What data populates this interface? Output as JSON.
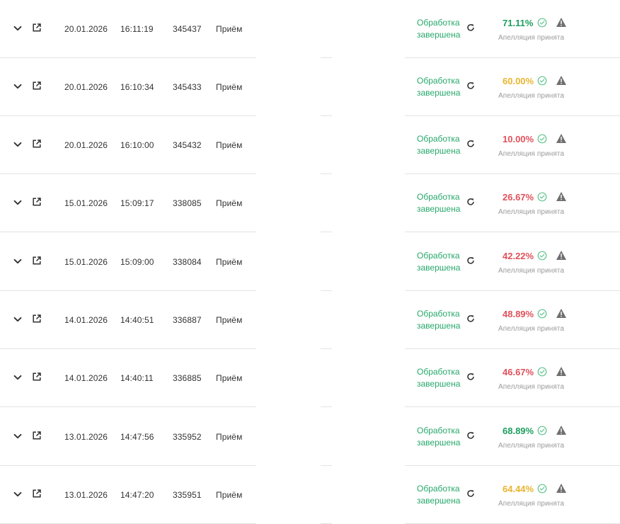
{
  "colors": {
    "status": "#27a86b",
    "score_green": "#1e9e5e",
    "score_yellow": "#e8b530",
    "score_red": "#e0515b",
    "appeal": "#9a9a9a",
    "separator": "#e3e3e3"
  },
  "icons": {
    "expand": "chevron-down-icon",
    "open": "external-link-icon",
    "refresh": "refresh-icon",
    "check": "check-circle-icon",
    "warning": "warning-triangle-icon"
  },
  "rows": [
    {
      "date": "20.01.2026",
      "time": "16:11:19",
      "id": "345437",
      "type": "Приём",
      "status": "Обработка завершена",
      "score": "71.11%",
      "score_level": "green",
      "appeal": "Апелляция принята"
    },
    {
      "date": "20.01.2026",
      "time": "16:10:34",
      "id": "345433",
      "type": "Приём",
      "status": "Обработка завершена",
      "score": "60.00%",
      "score_level": "yellow",
      "appeal": "Апелляция принята"
    },
    {
      "date": "20.01.2026",
      "time": "16:10:00",
      "id": "345432",
      "type": "Приём",
      "status": "Обработка завершена",
      "score": "10.00%",
      "score_level": "red",
      "appeal": "Апелляция принята"
    },
    {
      "date": "15.01.2026",
      "time": "15:09:17",
      "id": "338085",
      "type": "Приём",
      "status": "Обработка завершена",
      "score": "26.67%",
      "score_level": "red",
      "appeal": "Апелляция принята"
    },
    {
      "date": "15.01.2026",
      "time": "15:09:00",
      "id": "338084",
      "type": "Приём",
      "status": "Обработка завершена",
      "score": "42.22%",
      "score_level": "red",
      "appeal": "Апелляция принята"
    },
    {
      "date": "14.01.2026",
      "time": "14:40:51",
      "id": "336887",
      "type": "Приём",
      "status": "Обработка завершена",
      "score": "48.89%",
      "score_level": "red",
      "appeal": "Апелляция принята"
    },
    {
      "date": "14.01.2026",
      "time": "14:40:11",
      "id": "336885",
      "type": "Приём",
      "status": "Обработка завершена",
      "score": "46.67%",
      "score_level": "red",
      "appeal": "Апелляция принята"
    },
    {
      "date": "13.01.2026",
      "time": "14:47:56",
      "id": "335952",
      "type": "Приём",
      "status": "Обработка завершена",
      "score": "68.89%",
      "score_level": "green",
      "appeal": "Апелляция принята"
    },
    {
      "date": "13.01.2026",
      "time": "14:47:20",
      "id": "335951",
      "type": "Приём",
      "status": "Обработка завершена",
      "score": "64.44%",
      "score_level": "yellow",
      "appeal": "Апелляция принята"
    }
  ]
}
